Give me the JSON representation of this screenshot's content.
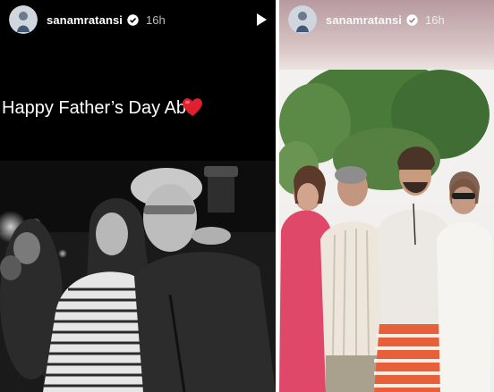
{
  "left_story": {
    "username": "sanamratansi",
    "timestamp": "16h",
    "caption": "Happy Father’s Day Abu",
    "heart_emoji": "❤️",
    "icons": {
      "verified": "verified-badge-icon",
      "play": "play-icon",
      "heart": "heart-icon"
    }
  },
  "right_story": {
    "username": "sanamratansi",
    "timestamp": "16h",
    "icons": {
      "verified": "verified-badge-icon"
    }
  },
  "colors": {
    "verified_badge": "#ffffff",
    "heart": "#e0202f",
    "left_background": "#000000",
    "right_background": "#f4f2f1"
  }
}
